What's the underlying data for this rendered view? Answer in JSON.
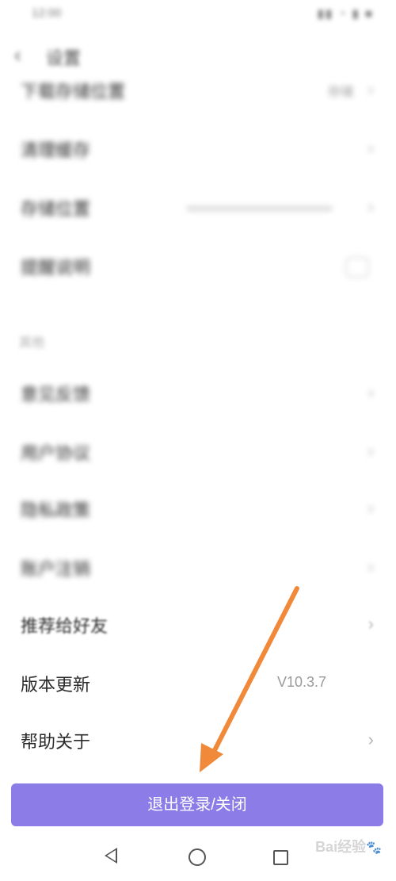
{
  "status_bar": {
    "time": "12:00",
    "icons": "▮▮ ◔ ▮ ■"
  },
  "header": {
    "title": "设置"
  },
  "section": {
    "title": "其他"
  },
  "rows": [
    {
      "label": "下载存储位置",
      "value": "存储"
    },
    {
      "label": "清理缓存",
      "value": ""
    },
    {
      "label": "存储位置",
      "value": ""
    },
    {
      "label": "提醒说明",
      "value": ""
    },
    {
      "label": "意见反馈",
      "value": ""
    },
    {
      "label": "用户协议",
      "value": ""
    },
    {
      "label": "隐私政策",
      "value": ""
    },
    {
      "label": "账户注销",
      "value": ""
    },
    {
      "label": "推荐给好友",
      "value": ""
    },
    {
      "label": "版本更新",
      "value": "V10.3.7"
    },
    {
      "label": "帮助关于",
      "value": ""
    }
  ],
  "logout": {
    "label": "退出登录/关闭"
  },
  "watermark": {
    "text": "Bai经验",
    "paw": "🐾"
  },
  "colors": {
    "accent": "#8c7ce8",
    "arrow": "#f08a3a"
  }
}
